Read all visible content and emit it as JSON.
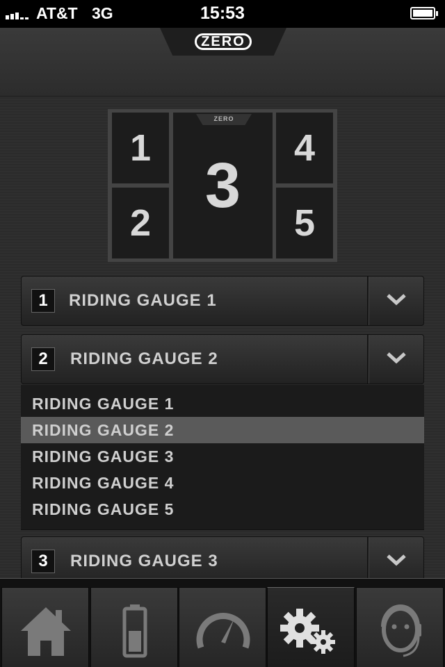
{
  "status_bar": {
    "carrier": "AT&T",
    "network": "3G",
    "time": "15:53"
  },
  "header": {
    "logo_text": "ZERO"
  },
  "preview": {
    "logo_text": "ZERO",
    "tiles": [
      "1",
      "2",
      "3",
      "4",
      "5"
    ]
  },
  "gauge_rows": [
    {
      "slot": "1",
      "label": "RIDING GAUGE 1"
    },
    {
      "slot": "2",
      "label": "RIDING GAUGE 2"
    },
    {
      "slot": "3",
      "label": "RIDING GAUGE 3"
    }
  ],
  "dropdown": {
    "options": [
      "RIDING GAUGE 1",
      "RIDING GAUGE 2",
      "RIDING GAUGE 3",
      "RIDING GAUGE 4",
      "RIDING GAUGE 5"
    ],
    "selected": "RIDING GAUGE 2"
  },
  "tab_bar": {
    "tabs": [
      {
        "icon": "home-icon"
      },
      {
        "icon": "battery-icon"
      },
      {
        "icon": "speedometer-icon"
      },
      {
        "icon": "settings-gears-icon",
        "active": true
      },
      {
        "icon": "support-headset-icon"
      }
    ]
  },
  "colors": {
    "background": "#2e2e2e",
    "selected_option": "#5a5a5a",
    "text": "#d0d0d0"
  }
}
